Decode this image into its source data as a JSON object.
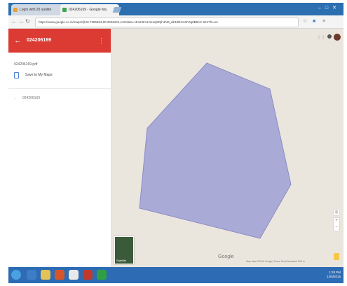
{
  "browser": {
    "tabs": [
      {
        "label": "Login with 25 sunlite",
        "active": false
      },
      {
        "label": "024206169 - Google Ma",
        "active": true
      }
    ],
    "url": "https://www.google.co.in/maps/@20.7396594,80.2536224,13z/data=!4m2!6m1!1s1qGDjh4hM_dk4d9iXsJ2Vtq0B8AC-9z4?hl=en",
    "back_icon": "back-arrow-icon",
    "forward_icon": "forward-arrow-icon",
    "reload_icon": "reload-icon"
  },
  "sidebar": {
    "title": "024206169",
    "subtitle": "024206169.pdf",
    "save_label": "Save to My Maps",
    "layer_item": "024206169",
    "accent_color": "#db3b33"
  },
  "map": {
    "polygon_fill": "#a9abd6",
    "polygon_stroke": "#8a8dc6",
    "background": "#ebe6dd",
    "sat_label": "Satellite",
    "google_label": "Google",
    "attribution": "Map data ©2016 Google   Terms   Send feedback   200 m"
  },
  "taskbar": {
    "time": "1:20 PM",
    "date": "12/5/2016"
  }
}
